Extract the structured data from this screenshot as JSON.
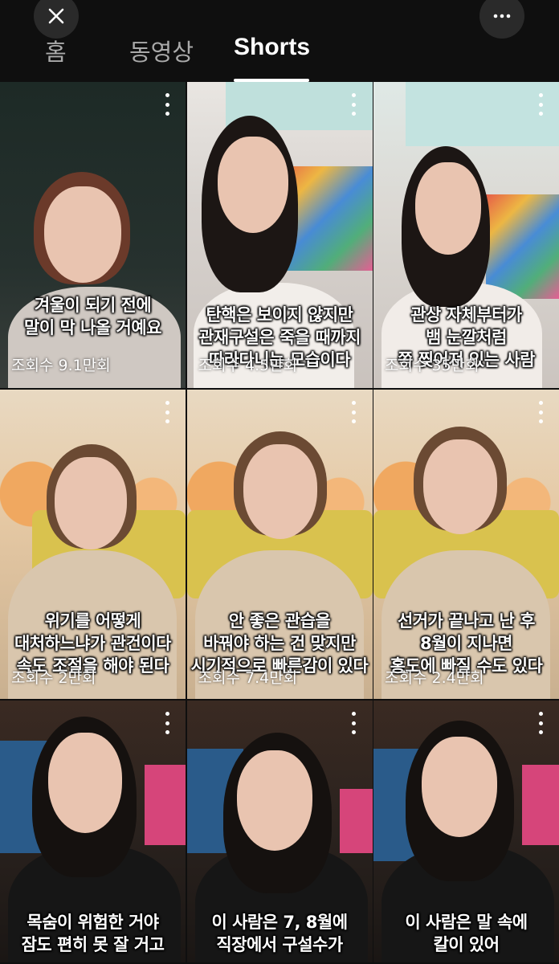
{
  "header": {
    "close_icon": "close-icon",
    "more_icon": "more-vertical-dots-icon",
    "tabs": [
      {
        "label": "홈",
        "active": false
      },
      {
        "label": "동영상",
        "active": false
      },
      {
        "label": "Shorts",
        "active": true
      }
    ]
  },
  "shorts": [
    {
      "caption": [
        "겨울이 되기 전에",
        "말이 막 나올 거예요"
      ],
      "views": "조회수 9.1만회"
    },
    {
      "caption": [
        "탄핵은 보이지 않지만",
        "관재구설은 죽을 때까지",
        "따라다니는 모습이다"
      ],
      "views": "조회수 4.5만회"
    },
    {
      "caption": [
        "관상 자체부터가",
        "뱀 눈깔처럼",
        "쪽 찢어져 있는 사람"
      ],
      "views": "조회수 35만회"
    },
    {
      "caption": [
        "위기를 어떻게",
        "대처하느냐가 관건이다",
        "속도 조절을 해야 된다"
      ],
      "views": "조회수 2만회"
    },
    {
      "caption": [
        "안 좋은 관습을",
        "바꿔야 하는 건 맞지만",
        "시기적으로 빠른감이 있다"
      ],
      "views": "조회수 7.4만회"
    },
    {
      "caption": [
        "선거가 끝나고 난 후",
        "8월이 지나면",
        "홍도에 빠질 수도 있다"
      ],
      "views": "조회수 2.4만회"
    },
    {
      "caption": [
        "목숨이 위험한 거야",
        "잠도 편히 못 잘 거고"
      ],
      "views": ""
    },
    {
      "caption": [
        "이 사람은 7, 8월에",
        "직장에서 구설수가"
      ],
      "views": ""
    },
    {
      "caption": [
        "이 사람은 말 속에",
        "칼이 있어"
      ],
      "views": ""
    }
  ]
}
